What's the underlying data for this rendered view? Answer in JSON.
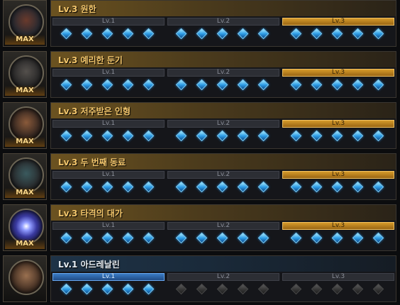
{
  "rows": [
    {
      "title": "Lv.3 원한",
      "max": "MAX",
      "lv1": "Lv.1",
      "lv2": "Lv.2",
      "lv3": "Lv.3",
      "active": 3
    },
    {
      "title": "Lv.3 예리한 둔기",
      "max": "MAX",
      "lv1": "Lv.1",
      "lv2": "Lv.2",
      "lv3": "Lv.3",
      "active": 3
    },
    {
      "title": "Lv.3 저주받은 인형",
      "max": "MAX",
      "lv1": "Lv.1",
      "lv2": "Lv.2",
      "lv3": "Lv.3",
      "active": 3
    },
    {
      "title": "Lv.3 두 번째 동료",
      "max": "MAX",
      "lv1": "Lv.1",
      "lv2": "Lv.2",
      "lv3": "Lv.3",
      "active": 3
    },
    {
      "title": "Lv.3 타격의 대가",
      "max": "MAX",
      "lv1": "Lv.1",
      "lv2": "Lv.2",
      "lv3": "Lv.3",
      "active": 3
    },
    {
      "title": "Lv.1 아드레날린",
      "max": "",
      "lv1": "Lv.1",
      "lv2": "Lv.2",
      "lv3": "Lv.3",
      "active": 1
    }
  ],
  "colors": {
    "gold": "#f3c66c",
    "gem": "#2f9ee8",
    "active_blue": "#3b7cc4"
  }
}
